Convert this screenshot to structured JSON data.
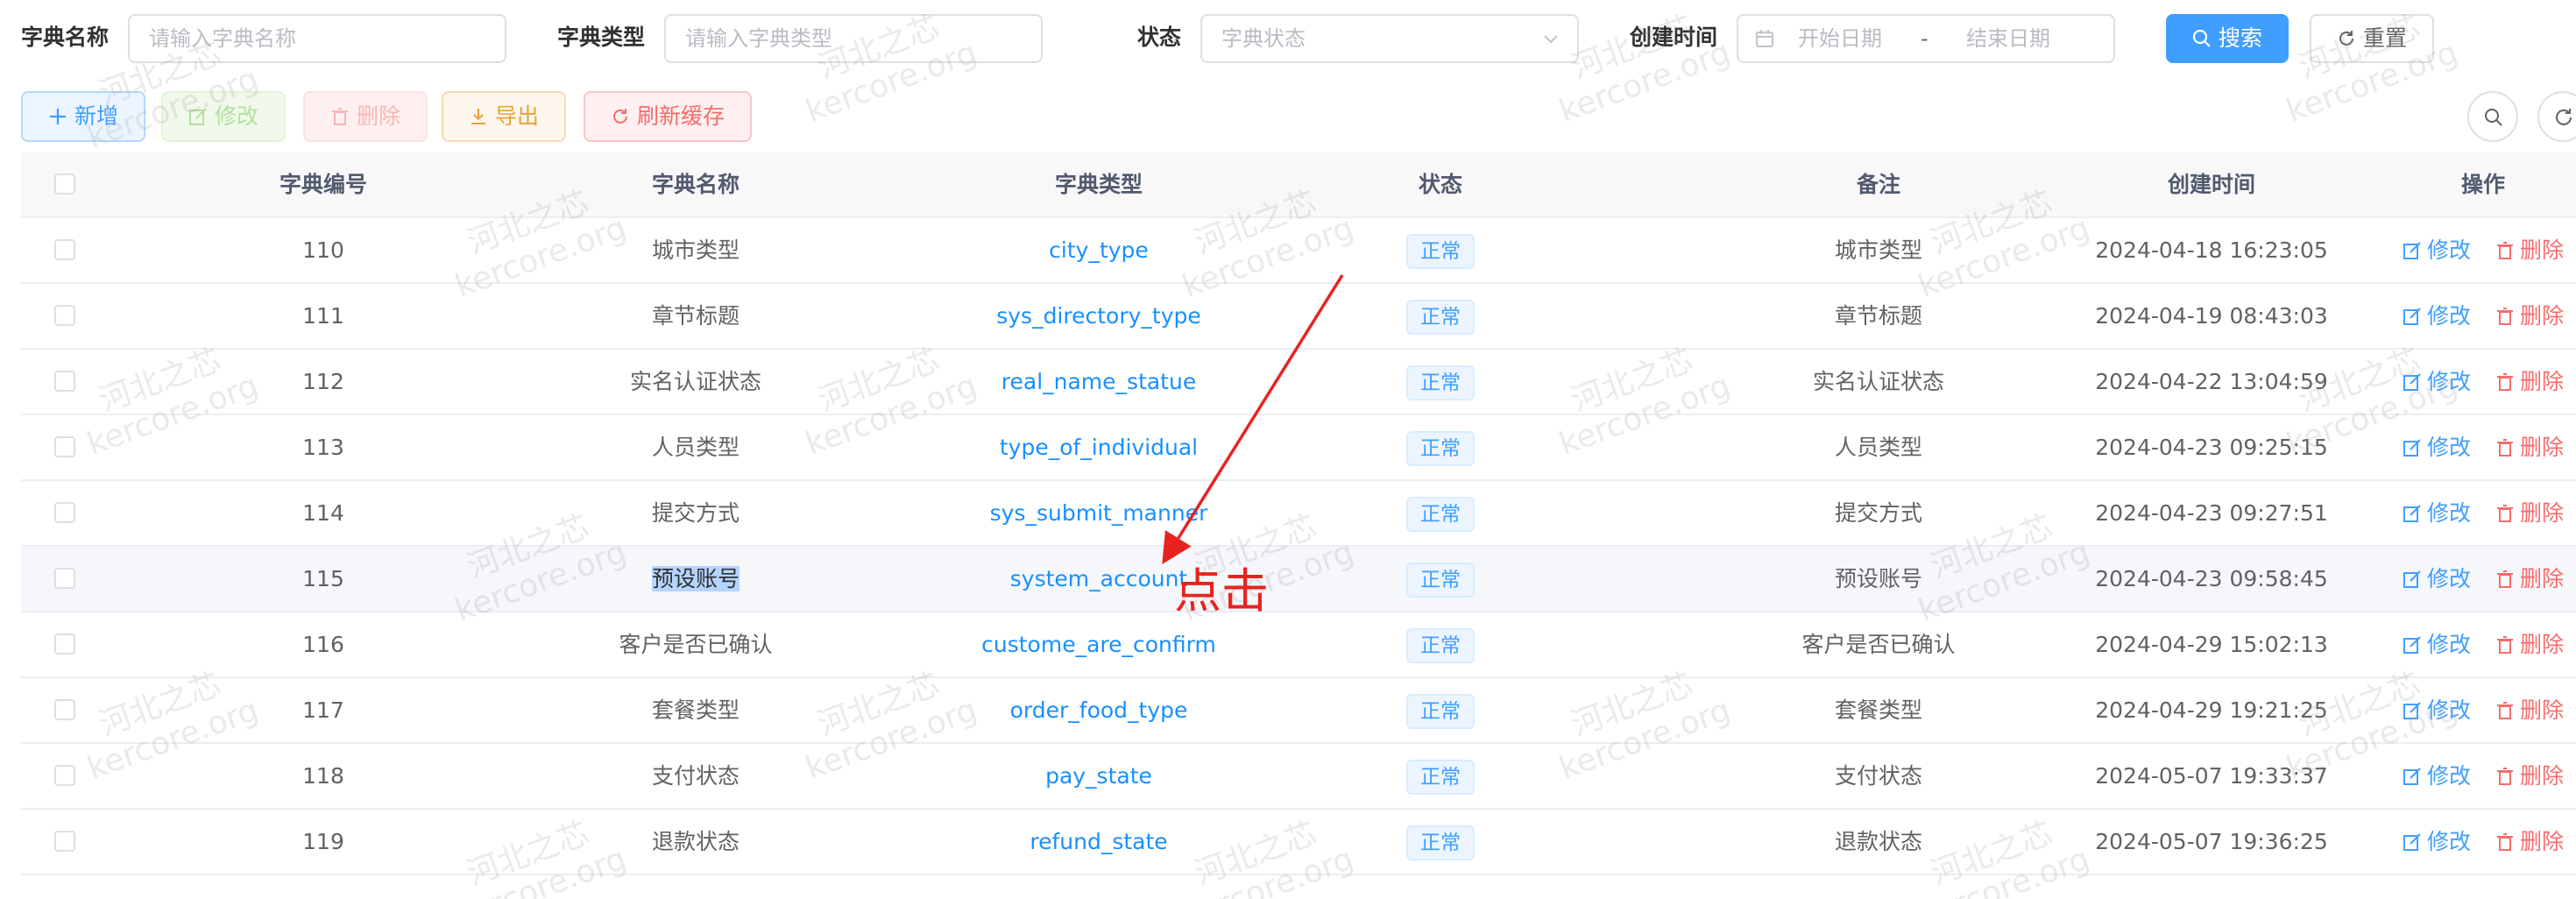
{
  "search": {
    "dict_name_label": "字典名称",
    "dict_name_placeholder": "请输入字典名称",
    "dict_type_label": "字典类型",
    "dict_type_placeholder": "请输入字典类型",
    "status_label": "状态",
    "status_placeholder": "字典状态",
    "create_time_label": "创建时间",
    "start_date_placeholder": "开始日期",
    "date_separator": "-",
    "end_date_placeholder": "结束日期",
    "search_button": "搜索",
    "reset_button": "重置"
  },
  "toolbar": {
    "add": "新增",
    "edit": "修改",
    "delete": "删除",
    "export": "导出",
    "refresh_cache": "刷新缓存"
  },
  "table": {
    "headers": [
      "字典编号",
      "字典名称",
      "字典类型",
      "状态",
      "备注",
      "创建时间",
      "操作"
    ],
    "edit_label": "修改",
    "delete_label": "删除",
    "rows": [
      {
        "id": "110",
        "name": "城市类型",
        "type": "city_type",
        "status": "正常",
        "remark": "城市类型",
        "time": "2024-04-18 16:23:05"
      },
      {
        "id": "111",
        "name": "章节标题",
        "type": "sys_directory_type",
        "status": "正常",
        "remark": "章节标题",
        "time": "2024-04-19 08:43:03"
      },
      {
        "id": "112",
        "name": "实名认证状态",
        "type": "real_name_statue",
        "status": "正常",
        "remark": "实名认证状态",
        "time": "2024-04-22 13:04:59"
      },
      {
        "id": "113",
        "name": "人员类型",
        "type": "type_of_individual",
        "status": "正常",
        "remark": "人员类型",
        "time": "2024-04-23 09:25:15"
      },
      {
        "id": "114",
        "name": "提交方式",
        "type": "sys_submit_manner",
        "status": "正常",
        "remark": "提交方式",
        "time": "2024-04-23 09:27:51"
      },
      {
        "id": "115",
        "name": "预设账号",
        "type": "system_account",
        "status": "正常",
        "remark": "预设账号",
        "time": "2024-04-23 09:58:45"
      },
      {
        "id": "116",
        "name": "客户是否已确认",
        "type": "custome_are_confirm",
        "status": "正常",
        "remark": "客户是否已确认",
        "time": "2024-04-29 15:02:13"
      },
      {
        "id": "117",
        "name": "套餐类型",
        "type": "order_food_type",
        "status": "正常",
        "remark": "套餐类型",
        "time": "2024-04-29 19:21:25"
      },
      {
        "id": "118",
        "name": "支付状态",
        "type": "pay_state",
        "status": "正常",
        "remark": "支付状态",
        "time": "2024-05-07 19:33:37"
      },
      {
        "id": "119",
        "name": "退款状态",
        "type": "refund_state",
        "status": "正常",
        "remark": "退款状态",
        "time": "2024-05-07 19:36:25"
      }
    ]
  },
  "annotation": {
    "text": "点击"
  },
  "watermark": {
    "line1": "河北之芯",
    "line2": "kercore.org"
  },
  "colors": {
    "primary": "#409eff",
    "danger": "#f56c6c",
    "warning": "#e6a23c",
    "annotation_red": "#e8231f"
  }
}
